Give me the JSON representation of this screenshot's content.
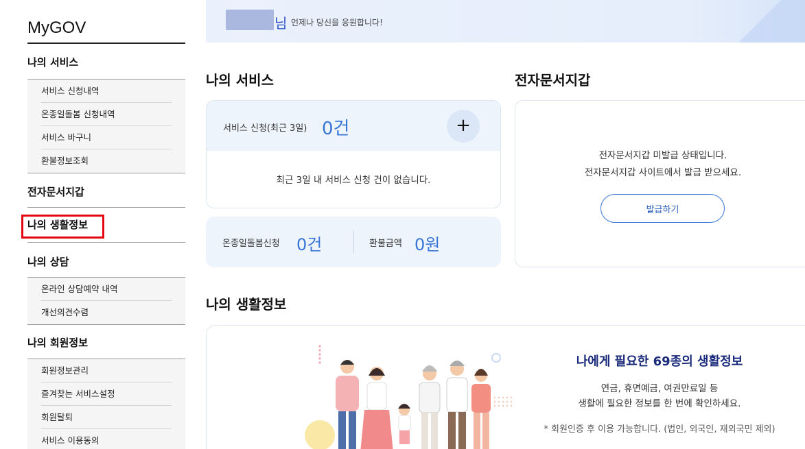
{
  "sidebar": {
    "brand": "MyGOV",
    "services": {
      "title": "나의 서비스",
      "items": [
        "서비스 신청내역",
        "온종일돌봄 신청내역",
        "서비스 바구니",
        "환불정보조회"
      ]
    },
    "wallet_title": "전자문서지갑",
    "life_title": "나의 생활정보",
    "consult": {
      "title": "나의 상담",
      "items": [
        "온라인 상담예약 내역",
        "개선의견수렴"
      ]
    },
    "member": {
      "title": "나의 회원정보",
      "items": [
        "회원정보관리",
        "즐겨찾는 서비스설정",
        "회원탈퇴",
        "서비스 이용동의"
      ]
    }
  },
  "banner": {
    "suffix": "님",
    "message": "언제나 당신을 응원합니다!"
  },
  "services": {
    "heading": "나의 서비스",
    "request_label": "서비스 신청(최근 3일)",
    "request_count": "0건",
    "plus_symbol": "+",
    "empty_message": "최근 3일 내 서비스 신청 건이 없습니다.",
    "care_label": "온종일돌봄신청",
    "care_count": "0건",
    "refund_label": "환불금액",
    "refund_amount": "0원"
  },
  "wallet": {
    "heading": "전자문서지갑",
    "line1": "전자문서지갑 미발급 상태입니다.",
    "line2": "전자문서지갑 사이트에서 발급 받으세요.",
    "button": "발급하기"
  },
  "life": {
    "heading": "나의 생활정보",
    "title": "나에게 필요한 69종의 생활정보",
    "line1": "연금, 휴면예금, 여권만료일 등",
    "line2": "생활에 필요한 정보를 한 번에 확인하세요.",
    "note": "* 회원인증 후 이용 가능합니다. (법인, 외국인, 재외국민 제외)"
  },
  "colors": {
    "accent": "#3a76d6",
    "highlight": "#e30613",
    "card_bg": "#eef4fc"
  }
}
